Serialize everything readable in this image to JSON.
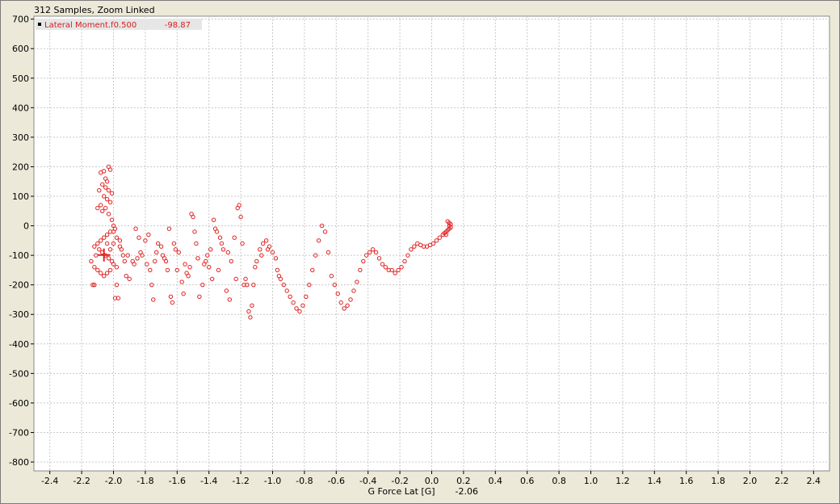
{
  "header": {
    "title": "312 Samples, Zoom Linked"
  },
  "legend": {
    "series_name": "Lateral Moment.f0.500",
    "cursor_value": "-98.87"
  },
  "axis": {
    "xlabel": "G Force Lat [G]",
    "cursor_x_value": "-2.06"
  },
  "colors": {
    "series": "#e02020",
    "grid": "#c8c8c8",
    "plot_bg": "#ffffff"
  },
  "chart_data": {
    "type": "scatter",
    "title": "",
    "xlabel": "G Force Lat [G]",
    "ylabel": "",
    "xlim": [
      -2.5,
      2.5
    ],
    "ylim": [
      -830,
      710
    ],
    "xticks": [
      "-2.4",
      "-2.2",
      "-2.0",
      "-1.8",
      "-1.6",
      "-1.4",
      "-1.2",
      "-1.0",
      "-0.8",
      "-0.6",
      "-0.4",
      "-0.2",
      "0.0",
      "0.2",
      "0.4",
      "0.6",
      "0.8",
      "1.0",
      "1.2",
      "1.4",
      "1.6",
      "1.8",
      "2.0",
      "2.2",
      "2.4"
    ],
    "yticks": [
      "700",
      "600",
      "500",
      "400",
      "300",
      "200",
      "100",
      "0",
      "-100",
      "-200",
      "-300",
      "-400",
      "-500",
      "-600",
      "-700",
      "-800"
    ],
    "grid": true,
    "legend_position": "top-left",
    "cursor": {
      "x": -2.06,
      "y": -98.87
    },
    "series": [
      {
        "name": "Lateral Moment.f0.500",
        "points": [
          [
            -2.08,
            180
          ],
          [
            -2.06,
            185
          ],
          [
            -2.05,
            160
          ],
          [
            -2.03,
            200
          ],
          [
            -2.02,
            190
          ],
          [
            -2.04,
            150
          ],
          [
            -2.07,
            140
          ],
          [
            -2.09,
            120
          ],
          [
            -2.05,
            130
          ],
          [
            -2.03,
            120
          ],
          [
            -2.01,
            110
          ],
          [
            -2.02,
            80
          ],
          [
            -2.04,
            90
          ],
          [
            -2.06,
            100
          ],
          [
            -2.08,
            70
          ],
          [
            -2.1,
            60
          ],
          [
            -2.07,
            50
          ],
          [
            -2.05,
            60
          ],
          [
            -2.03,
            40
          ],
          [
            -2.01,
            20
          ],
          [
            -2.0,
            0
          ],
          [
            -1.99,
            -10
          ],
          [
            -2.02,
            -20
          ],
          [
            -2.04,
            -30
          ],
          [
            -2.06,
            -40
          ],
          [
            -2.08,
            -50
          ],
          [
            -2.1,
            -60
          ],
          [
            -2.12,
            -70
          ],
          [
            -2.09,
            -80
          ],
          [
            -2.07,
            -90
          ],
          [
            -2.05,
            -100
          ],
          [
            -2.03,
            -110
          ],
          [
            -2.01,
            -120
          ],
          [
            -2.0,
            -130
          ],
          [
            -1.98,
            -140
          ],
          [
            -2.02,
            -150
          ],
          [
            -2.04,
            -160
          ],
          [
            -2.06,
            -170
          ],
          [
            -2.08,
            -160
          ],
          [
            -2.1,
            -150
          ],
          [
            -2.12,
            -140
          ],
          [
            -2.14,
            -120
          ],
          [
            -2.11,
            -100
          ],
          [
            -2.13,
            -200
          ],
          [
            -2.12,
            -200
          ],
          [
            -1.98,
            -200
          ],
          [
            -1.97,
            -245
          ],
          [
            -1.99,
            -245
          ],
          [
            -2.0,
            -60
          ],
          [
            -2.02,
            -80
          ],
          [
            -1.98,
            -40
          ],
          [
            -1.96,
            -50
          ],
          [
            -1.95,
            -80
          ],
          [
            -1.94,
            -100
          ],
          [
            -1.93,
            -120
          ],
          [
            -1.92,
            -170
          ],
          [
            -1.9,
            -180
          ],
          [
            -1.88,
            -120
          ],
          [
            -1.87,
            -130
          ],
          [
            -1.86,
            -10
          ],
          [
            -1.84,
            -40
          ],
          [
            -1.83,
            -90
          ],
          [
            -1.82,
            -100
          ],
          [
            -1.8,
            -50
          ],
          [
            -1.78,
            -30
          ],
          [
            -1.77,
            -150
          ],
          [
            -1.76,
            -200
          ],
          [
            -1.75,
            -250
          ],
          [
            -1.74,
            -120
          ],
          [
            -1.72,
            -60
          ],
          [
            -1.7,
            -70
          ],
          [
            -1.69,
            -100
          ],
          [
            -1.68,
            -110
          ],
          [
            -1.66,
            -150
          ],
          [
            -1.65,
            -10
          ],
          [
            -1.64,
            -240
          ],
          [
            -1.63,
            -260
          ],
          [
            -1.62,
            -60
          ],
          [
            -1.61,
            -80
          ],
          [
            -1.59,
            -90
          ],
          [
            -1.57,
            -190
          ],
          [
            -1.56,
            -230
          ],
          [
            -1.55,
            -130
          ],
          [
            -1.54,
            -160
          ],
          [
            -1.52,
            -140
          ],
          [
            -1.51,
            40
          ],
          [
            -1.5,
            30
          ],
          [
            -1.49,
            -20
          ],
          [
            -1.48,
            -60
          ],
          [
            -1.46,
            -240
          ],
          [
            -1.44,
            -200
          ],
          [
            -1.42,
            -120
          ],
          [
            -1.41,
            -100
          ],
          [
            -1.4,
            -140
          ],
          [
            -1.38,
            -180
          ],
          [
            -1.37,
            20
          ],
          [
            -1.36,
            -10
          ],
          [
            -1.35,
            -20
          ],
          [
            -1.33,
            -40
          ],
          [
            -1.32,
            -60
          ],
          [
            -1.31,
            -80
          ],
          [
            -1.29,
            -220
          ],
          [
            -1.27,
            -250
          ],
          [
            -1.26,
            -120
          ],
          [
            -1.24,
            -40
          ],
          [
            -1.22,
            60
          ],
          [
            -1.21,
            70
          ],
          [
            -1.2,
            30
          ],
          [
            -1.19,
            -60
          ],
          [
            -1.17,
            -180
          ],
          [
            -1.16,
            -200
          ],
          [
            -1.15,
            -290
          ],
          [
            -1.14,
            -310
          ],
          [
            -1.13,
            -270
          ],
          [
            -1.12,
            -200
          ],
          [
            -1.1,
            -120
          ],
          [
            -1.08,
            -80
          ],
          [
            -1.06,
            -60
          ],
          [
            -1.04,
            -50
          ],
          [
            -1.02,
            -70
          ],
          [
            -1.0,
            -90
          ],
          [
            -0.98,
            -110
          ],
          [
            -0.97,
            -150
          ],
          [
            -0.96,
            -170
          ],
          [
            -0.95,
            -180
          ],
          [
            -0.93,
            -200
          ],
          [
            -0.91,
            -220
          ],
          [
            -0.89,
            -240
          ],
          [
            -0.87,
            -260
          ],
          [
            -0.85,
            -280
          ],
          [
            -0.83,
            -290
          ],
          [
            -0.81,
            -270
          ],
          [
            -0.79,
            -240
          ],
          [
            -0.77,
            -200
          ],
          [
            -0.75,
            -150
          ],
          [
            -0.73,
            -100
          ],
          [
            -0.71,
            -50
          ],
          [
            -0.69,
            0
          ],
          [
            -0.67,
            -20
          ],
          [
            -0.65,
            -90
          ],
          [
            -0.63,
            -170
          ],
          [
            -0.61,
            -200
          ],
          [
            -0.59,
            -230
          ],
          [
            -0.57,
            -260
          ],
          [
            -0.55,
            -280
          ],
          [
            -0.53,
            -270
          ],
          [
            -0.51,
            -250
          ],
          [
            -0.49,
            -220
          ],
          [
            -0.47,
            -190
          ],
          [
            -0.45,
            -150
          ],
          [
            -0.43,
            -120
          ],
          [
            -0.41,
            -100
          ],
          [
            -0.39,
            -90
          ],
          [
            -0.37,
            -80
          ],
          [
            -0.35,
            -90
          ],
          [
            -0.33,
            -110
          ],
          [
            -0.31,
            -130
          ],
          [
            -0.29,
            -140
          ],
          [
            -0.27,
            -150
          ],
          [
            -0.25,
            -150
          ],
          [
            -0.23,
            -160
          ],
          [
            -0.21,
            -150
          ],
          [
            -0.19,
            -140
          ],
          [
            -0.17,
            -120
          ],
          [
            -0.15,
            -100
          ],
          [
            -0.13,
            -80
          ],
          [
            -0.11,
            -70
          ],
          [
            -0.09,
            -60
          ],
          [
            -0.07,
            -65
          ],
          [
            -0.05,
            -70
          ],
          [
            -0.03,
            -70
          ],
          [
            -0.01,
            -65
          ],
          [
            0.01,
            -60
          ],
          [
            0.03,
            -50
          ],
          [
            0.05,
            -40
          ],
          [
            0.07,
            -30
          ],
          [
            0.08,
            -25
          ],
          [
            0.09,
            -20
          ],
          [
            0.1,
            -15
          ],
          [
            0.11,
            -10
          ],
          [
            0.11,
            0
          ],
          [
            0.11,
            10
          ],
          [
            0.12,
            5
          ],
          [
            0.12,
            -5
          ],
          [
            0.1,
            15
          ],
          [
            0.09,
            -30
          ],
          [
            -2.04,
            -60
          ],
          [
            -2.0,
            -20
          ],
          [
            -1.96,
            -70
          ],
          [
            -1.91,
            -100
          ],
          [
            -1.85,
            -110
          ],
          [
            -1.79,
            -130
          ],
          [
            -1.73,
            -90
          ],
          [
            -1.67,
            -120
          ],
          [
            -1.6,
            -150
          ],
          [
            -1.53,
            -170
          ],
          [
            -1.47,
            -110
          ],
          [
            -1.43,
            -130
          ],
          [
            -1.39,
            -80
          ],
          [
            -1.34,
            -150
          ],
          [
            -1.28,
            -90
          ],
          [
            -1.23,
            -180
          ],
          [
            -1.18,
            -200
          ],
          [
            -1.11,
            -140
          ],
          [
            -1.07,
            -100
          ],
          [
            -1.03,
            -80
          ]
        ]
      }
    ]
  }
}
